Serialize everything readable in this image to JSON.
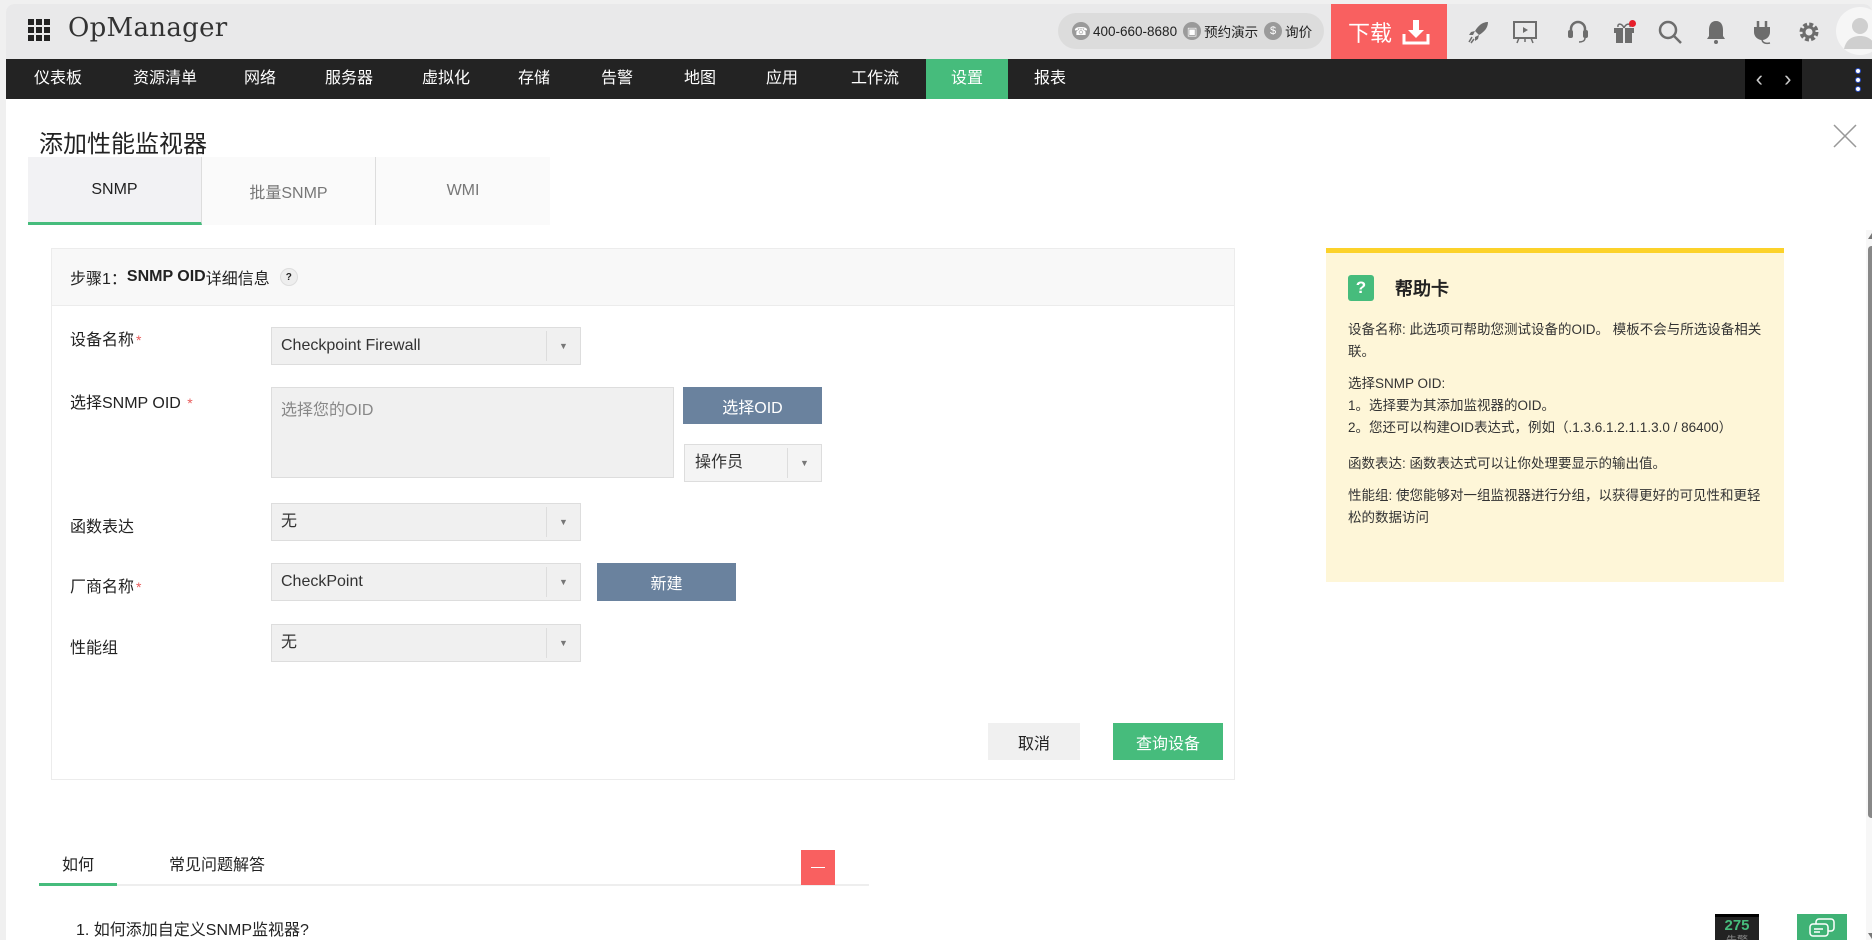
{
  "app": {
    "title": "OpManager"
  },
  "topbar": {
    "phone": "400-660-8680",
    "demo_label": "预约演示",
    "price_label": "询价",
    "download_label": "下载",
    "icons": [
      "rocket-icon",
      "presentation-icon",
      "headset-icon",
      "gift-icon",
      "search-icon",
      "bell-icon",
      "plug-icon",
      "gear-icon",
      "avatar-icon"
    ]
  },
  "nav": {
    "items": [
      {
        "label": "仪表板"
      },
      {
        "label": "资源清单"
      },
      {
        "label": "网络"
      },
      {
        "label": "服务器"
      },
      {
        "label": "虚拟化"
      },
      {
        "label": "存储"
      },
      {
        "label": "告警"
      },
      {
        "label": "地图"
      },
      {
        "label": "应用"
      },
      {
        "label": "工作流"
      },
      {
        "label": "设置",
        "active": true
      },
      {
        "label": "报表"
      }
    ],
    "prev": "‹",
    "next": "›"
  },
  "page": {
    "title": "添加性能监视器",
    "tabs": [
      {
        "label": "SNMP",
        "active": true
      },
      {
        "label": "批量SNMP"
      },
      {
        "label": "WMI"
      }
    ]
  },
  "form": {
    "step_prefix": "步骤1：",
    "step_title": "SNMP OID",
    "step_suffix": "详细信息",
    "help_q": "?",
    "device_label": "设备名称",
    "device_value": "Checkpoint Firewall",
    "oid_label": "选择SNMP OID",
    "oid_placeholder": "选择您的OID",
    "select_oid_btn": "选择OID",
    "operator_value": "操作员",
    "function_label": "函数表达",
    "function_value": "无",
    "vendor_label": "厂商名称",
    "vendor_value": "CheckPoint",
    "new_btn": "新建",
    "perf_group_label": "性能组",
    "perf_group_value": "无",
    "required_mark": "*",
    "cancel_btn": "取消",
    "query_btn": "查询设备"
  },
  "help_card": {
    "icon": "?",
    "title": "帮助卡",
    "p1": "设备名称: 此选项可帮助您测试设备的OID。 模板不会与所选设备相关联。",
    "p2_title": "选择SNMP OID:",
    "p2_line1": "1。选择要为其添加监视器的OID。",
    "p2_line2": "2。您还可以构建OID表达式，例如（.1.3.6.1.2.1.1.3.0 / 86400）",
    "p3": "函数表达: 函数表达式可以让你处理要显示的输出值。",
    "p4": "性能组: 使您能够对一组监视器进行分组，以获得更好的可见性和更轻松的数据访问"
  },
  "bottom": {
    "tabs": [
      {
        "label": "如何",
        "active": true
      },
      {
        "label": "常见问题解答"
      }
    ],
    "faq_first": "1. 如何添加自定义SNMP监视器?",
    "alarm_count": "275",
    "alarm_label": "告警"
  },
  "colors": {
    "accent_green": "#46bc7c",
    "download_red": "#f96060",
    "slate_button": "#6a829e",
    "help_card_bg": "#fef6d8",
    "help_card_border": "#fcd22a"
  }
}
